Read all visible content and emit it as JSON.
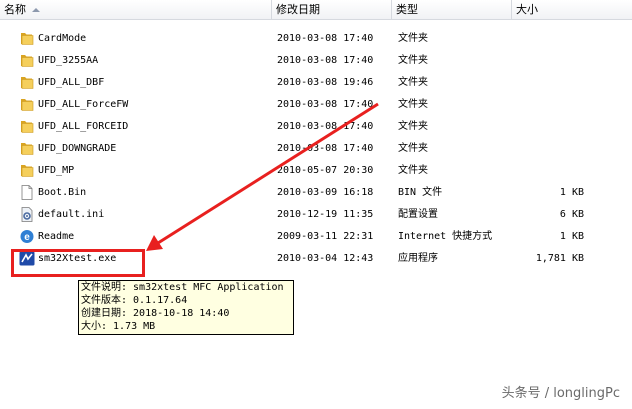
{
  "columns": {
    "name": "名称",
    "modified": "修改日期",
    "type": "类型",
    "size": "大小"
  },
  "files": [
    {
      "name": "CardMode",
      "date": "2010-03-08 17:40",
      "type": "文件夹",
      "size": "",
      "icon": "folder-icon"
    },
    {
      "name": "UFD_3255AA",
      "date": "2010-03-08 17:40",
      "type": "文件夹",
      "size": "",
      "icon": "folder-icon"
    },
    {
      "name": "UFD_ALL_DBF",
      "date": "2010-03-08 19:46",
      "type": "文件夹",
      "size": "",
      "icon": "folder-icon"
    },
    {
      "name": "UFD_ALL_ForceFW",
      "date": "2010-03-08 17:40",
      "type": "文件夹",
      "size": "",
      "icon": "folder-icon"
    },
    {
      "name": "UFD_ALL_FORCEID",
      "date": "2010-03-08 17:40",
      "type": "文件夹",
      "size": "",
      "icon": "folder-icon"
    },
    {
      "name": "UFD_DOWNGRADE",
      "date": "2010-03-08 17:40",
      "type": "文件夹",
      "size": "",
      "icon": "folder-icon"
    },
    {
      "name": "UFD_MP",
      "date": "2010-05-07 20:30",
      "type": "文件夹",
      "size": "",
      "icon": "folder-icon"
    },
    {
      "name": "Boot.Bin",
      "date": "2010-03-09 16:18",
      "type": "BIN 文件",
      "size": "1 KB",
      "icon": "file-icon"
    },
    {
      "name": "default.ini",
      "date": "2010-12-19 11:35",
      "type": "配置设置",
      "size": "6 KB",
      "icon": "settings-file-icon"
    },
    {
      "name": "Readme",
      "date": "2009-03-11 22:31",
      "type": "Internet 快捷方式",
      "size": "1 KB",
      "icon": "internet-shortcut-icon"
    },
    {
      "name": "sm32Xtest.exe",
      "date": "2010-03-04 12:43",
      "type": "应用程序",
      "size": "1,781 KB",
      "icon": "application-icon"
    }
  ],
  "tooltip": {
    "line1": "文件说明: sm32xtest MFC Application",
    "line2": "文件版本: 0.1.17.64",
    "line3": "创建日期: 2018-10-18 14:40",
    "line4": "大小: 1.73 MB"
  },
  "watermark": "头条号 / longlingPc",
  "colors": {
    "annotation": "#e8201f",
    "folder": "#f0c24a",
    "tooltip_bg": "#ffffe1"
  }
}
